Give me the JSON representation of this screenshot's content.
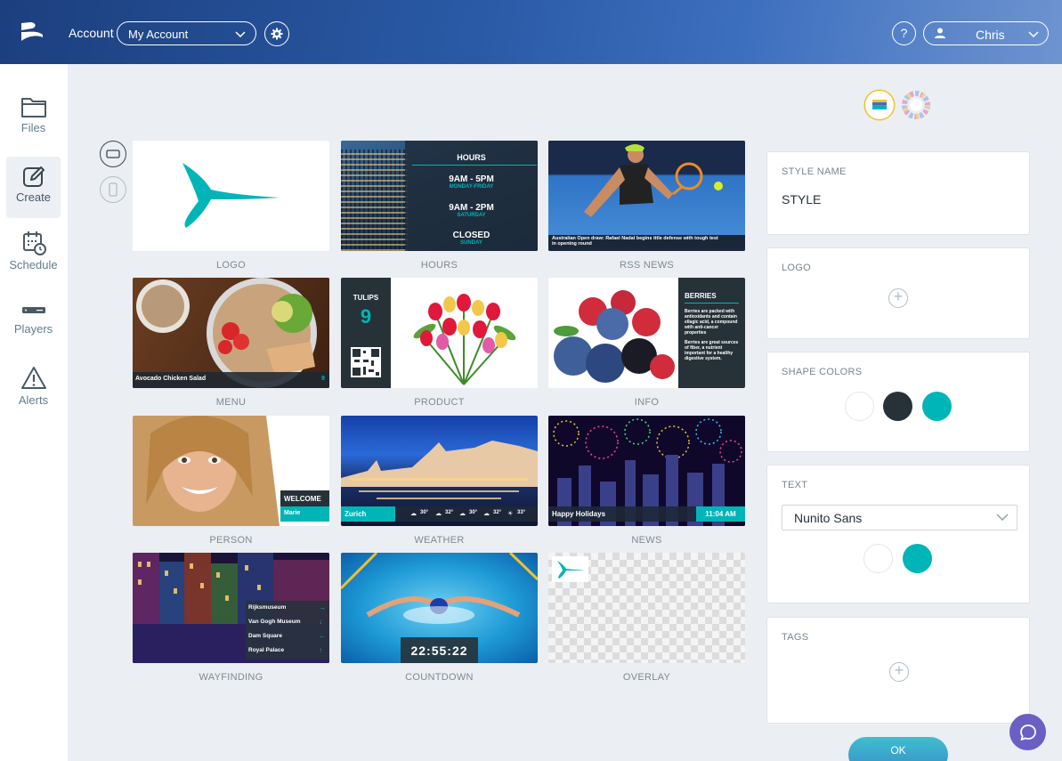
{
  "header": {
    "account_label": "Account",
    "account_select": "My Account",
    "help_label": "?",
    "user_name": "Chris"
  },
  "sidebar": {
    "items": [
      {
        "label": "Files",
        "icon": "folder-icon"
      },
      {
        "label": "Create",
        "icon": "create-icon",
        "active": true
      },
      {
        "label": "Schedule",
        "icon": "calendar-clock-icon"
      },
      {
        "label": "Players",
        "icon": "player-device-icon"
      },
      {
        "label": "Alerts",
        "icon": "alert-triangle-icon"
      }
    ]
  },
  "templates": [
    {
      "caption": "LOGO"
    },
    {
      "caption": "HOURS",
      "heading": "HOURS",
      "rows": [
        {
          "time": "9AM - 5PM",
          "days": "MONDAY-FRIDAY"
        },
        {
          "time": "9AM - 2PM",
          "days": "SATURDAY"
        },
        {
          "time": "CLOSED",
          "days": "SUNDAY"
        }
      ]
    },
    {
      "caption": "RSS NEWS",
      "headline": "Australian Open draw: Rafael Nadal begins title defense with tough test in opening round"
    },
    {
      "caption": "MENU",
      "item": "Avocado Chicken Salad",
      "price": "9"
    },
    {
      "caption": "PRODUCT",
      "name": "TULIPS",
      "price": "9"
    },
    {
      "caption": "INFO",
      "heading": "BERRIES",
      "para1": "Berries are packed with antioxidants and contain ellagic acid, a compound with anti-cancer properties",
      "para2": "Berries are great sources of fiber, a nutrient important for a healthy digestive system."
    },
    {
      "caption": "PERSON",
      "welcome": "WELCOME",
      "name": "Marie"
    },
    {
      "caption": "WEATHER",
      "city": "Zurich",
      "temps": [
        "30°",
        "32°",
        "30°",
        "32°",
        "33°"
      ]
    },
    {
      "caption": "NEWS",
      "title": "Happy Holidays",
      "time": "11:04 AM"
    },
    {
      "caption": "WAYFINDING",
      "places": [
        {
          "name": "Rijksmuseum",
          "arrow": "→"
        },
        {
          "name": "Van Gogh Museum",
          "arrow": "↓"
        },
        {
          "name": "Dam Square",
          "arrow": "←"
        },
        {
          "name": "Royal Palace",
          "arrow": "↑"
        }
      ]
    },
    {
      "caption": "COUNTDOWN",
      "timer": "22:55:22"
    },
    {
      "caption": "OVERLAY"
    }
  ],
  "panel": {
    "style_name_label": "STYLE NAME",
    "style_name_value": "STYLE",
    "logo_label": "LOGO",
    "shape_colors_label": "SHAPE COLORS",
    "shape_colors": [
      "#ffffff",
      "#263238",
      "#00b5b8"
    ],
    "text_label": "TEXT",
    "font_value": "Nunito Sans",
    "text_colors": [
      "#ffffff",
      "#00b5b8"
    ],
    "tags_label": "TAGS",
    "ok_label": "OK"
  },
  "colors": {
    "accent": "#00b5b8",
    "dark": "#263238",
    "header": "#2a5aa6"
  }
}
